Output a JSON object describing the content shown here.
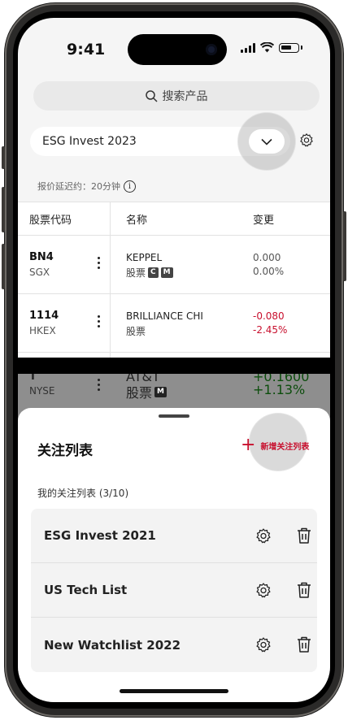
{
  "status": {
    "time": "9:41"
  },
  "search": {
    "placeholder": "搜索产品"
  },
  "watchlist": {
    "selected": "ESG Invest 2023"
  },
  "delay_note": "报价延迟约：20分钟",
  "table": {
    "headers": [
      "股票代码",
      "名称",
      "变更"
    ],
    "rows": [
      {
        "code": "BN4",
        "exchange": "SGX",
        "name": "KEPPEL",
        "type": "股票",
        "badges": [
          "C",
          "M"
        ],
        "change": "0.000",
        "change_pct": "0.00%",
        "color": "#666666"
      },
      {
        "code": "1114",
        "exchange": "HKEX",
        "name": "BRILLIANCE CHI",
        "type": "股票",
        "badges": [],
        "change": "-0.080",
        "change_pct": "-2.45%",
        "color": "#c8102e"
      }
    ],
    "partial_row": {
      "code": "T",
      "exchange": "NYSE",
      "name": "AT&T",
      "type": "股票",
      "badges": [
        "M"
      ],
      "change": "+0.1600",
      "change_pct": "+1.13%",
      "color": "#1a7a1a"
    }
  },
  "sheet": {
    "title": "关注列表",
    "add_label": "新增关注列表",
    "subtitle": "我的关注列表 (3/10)",
    "items": [
      {
        "label": "ESG Invest 2021"
      },
      {
        "label": "US Tech List"
      },
      {
        "label": "New Watchlist 2022"
      }
    ]
  },
  "colors": {
    "accent": "#c8102e",
    "negative": "#c8102e",
    "positive": "#1a7a1a"
  }
}
